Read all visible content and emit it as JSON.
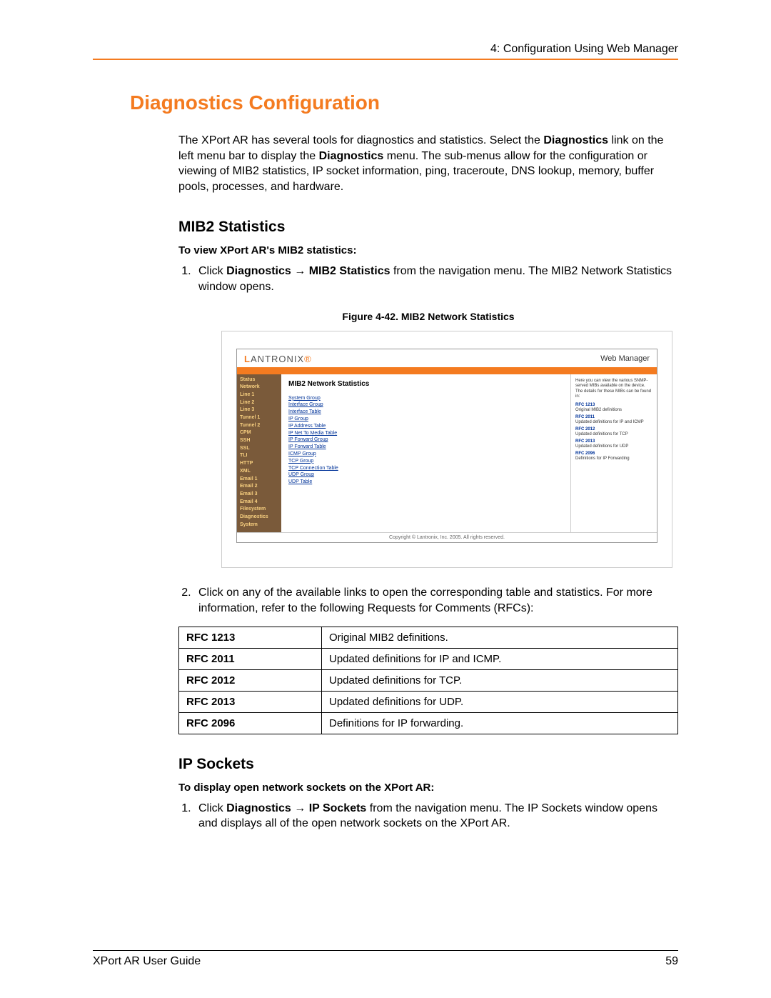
{
  "header": {
    "chapter": "4: Configuration Using Web Manager"
  },
  "h1": "Diagnostics Configuration",
  "intro_pre": "The XPort AR has several tools for diagnostics and statistics.  Select the ",
  "intro_bold1": "Diagnostics",
  "intro_mid": " link on the left menu bar to display the ",
  "intro_bold2": "Diagnostics",
  "intro_post": " menu.  The sub-menus allow for the configuration or viewing of MIB2 statistics, IP socket information, ping, traceroute, DNS lookup, memory, buffer pools, processes, and hardware.",
  "mib2": {
    "heading": "MIB2 Statistics",
    "lead": "To view XPort AR's MIB2 statistics:",
    "step1_pre": "Click ",
    "step1_b1": "Diagnostics",
    "step1_arrow": " → ",
    "step1_b2": "MIB2 Statistics",
    "step1_post": " from the navigation menu. The MIB2 Network Statistics window opens.",
    "fig_caption": "Figure 4-42. MIB2 Network Statistics",
    "step2": "Click on any of the available links to open the corresponding table and statistics. For more information, refer to the following Requests for Comments (RFCs):"
  },
  "screenshot": {
    "logo_l": "L",
    "logo_rest": "ANTRONIX",
    "wm": "Web Manager",
    "sidebar": [
      "Status",
      "Network",
      "Line 1",
      "Line 2",
      "Line 3",
      "Tunnel 1",
      "Tunnel 2",
      "CPM",
      "SSH",
      "SSL",
      "TLI",
      "HTTP",
      "XML",
      "Email 1",
      "Email 2",
      "Email 3",
      "Email 4",
      "Filesystem",
      "Diagnostics",
      "System"
    ],
    "center_title": "MIB2 Network Statistics",
    "links": [
      "System Group",
      "Interface Group",
      "Interface Table",
      "IP Group",
      "IP Address Table",
      "IP Net To Media Table",
      "IP Forward Group",
      "IP Forward Table",
      "ICMP Group",
      "TCP Group",
      "TCP Connection Table",
      "UDP Group",
      "UDP Table"
    ],
    "right_intro": "Here you can view the various SNMP-served MIBs available on the device. The details for these MIBs can be found in:",
    "right_rfcs": [
      {
        "t": "RFC 1213",
        "d": "Original MIB2 definitions"
      },
      {
        "t": "RFC 2011",
        "d": "Updated definitions for IP and ICMP"
      },
      {
        "t": "RFC 2012",
        "d": "Updated definitions for TCP"
      },
      {
        "t": "RFC 2013",
        "d": "Updated definitions for UDP"
      },
      {
        "t": "RFC 2096",
        "d": "Definitions for IP Forwarding"
      }
    ],
    "copyright": "Copyright © Lantronix, Inc. 2005. All rights reserved."
  },
  "rfc_table": [
    {
      "k": "RFC 1213",
      "v": "Original MIB2 definitions."
    },
    {
      "k": "RFC 2011",
      "v": "Updated definitions for IP and ICMP."
    },
    {
      "k": "RFC 2012",
      "v": "Updated definitions for TCP."
    },
    {
      "k": "RFC 2013",
      "v": "Updated definitions for UDP."
    },
    {
      "k": "RFC 2096",
      "v": "Definitions for IP forwarding."
    }
  ],
  "ipsockets": {
    "heading": "IP Sockets",
    "lead": "To display open network sockets on the XPort AR:",
    "step1_pre": "Click ",
    "step1_b1": "Diagnostics",
    "step1_arrow": " → ",
    "step1_b2": "IP Sockets",
    "step1_post": " from the navigation menu. The IP Sockets window opens and displays all of the open network sockets on the XPort AR."
  },
  "footer": {
    "left": "XPort AR User Guide",
    "right": "59"
  }
}
